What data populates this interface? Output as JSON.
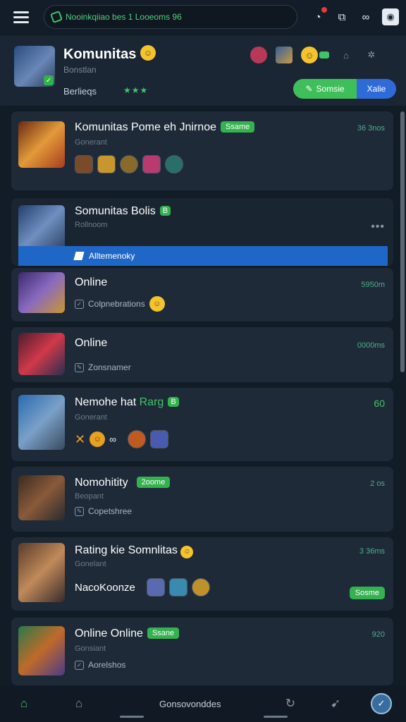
{
  "search": {
    "value": "Nooinkqiiao bes 1 Looeoms 96"
  },
  "header": {
    "title": "Komunitas",
    "subtitle": "Bonstlan",
    "caption": "Berlieqs",
    "stars": "★★★",
    "btn_primary": "Somsie",
    "btn_secondary": "Xalie"
  },
  "cards": [
    {
      "title": "Komunitas Pome eh Jnirnoe",
      "tag": "Ssame",
      "sub": "Gonerant",
      "meta": "36 3nos"
    },
    {
      "title": "Somunitas Bolis",
      "tag": "B",
      "sub": "Rollnoom",
      "banner": "Alltemenoky"
    },
    {
      "title": "Online",
      "row": "Colpnebrations",
      "meta": "5950m"
    },
    {
      "title": "Online",
      "row": "Zonsnamer",
      "meta": "0000ms"
    },
    {
      "title_a": "Nemohe hat",
      "title_b": "Rarg",
      "tag": "B",
      "sub": "Gonerant",
      "meta": "60"
    },
    {
      "title": "Nomohitity",
      "tag": "2oome",
      "sub": "Beopant",
      "row": "Copetshree",
      "meta": "2 os"
    },
    {
      "title": "Rating kie Somnlitas",
      "sub": "Gonelant",
      "row": "NacoKoonze",
      "meta": "3 36ms",
      "tag": "Sosme"
    },
    {
      "title": "Online Online",
      "tag": "Ssane",
      "sub": "Gonsiant",
      "row": "Aorelshos",
      "meta": "920"
    }
  ],
  "bottom_nav": {
    "label": "Gonsovonddes"
  }
}
